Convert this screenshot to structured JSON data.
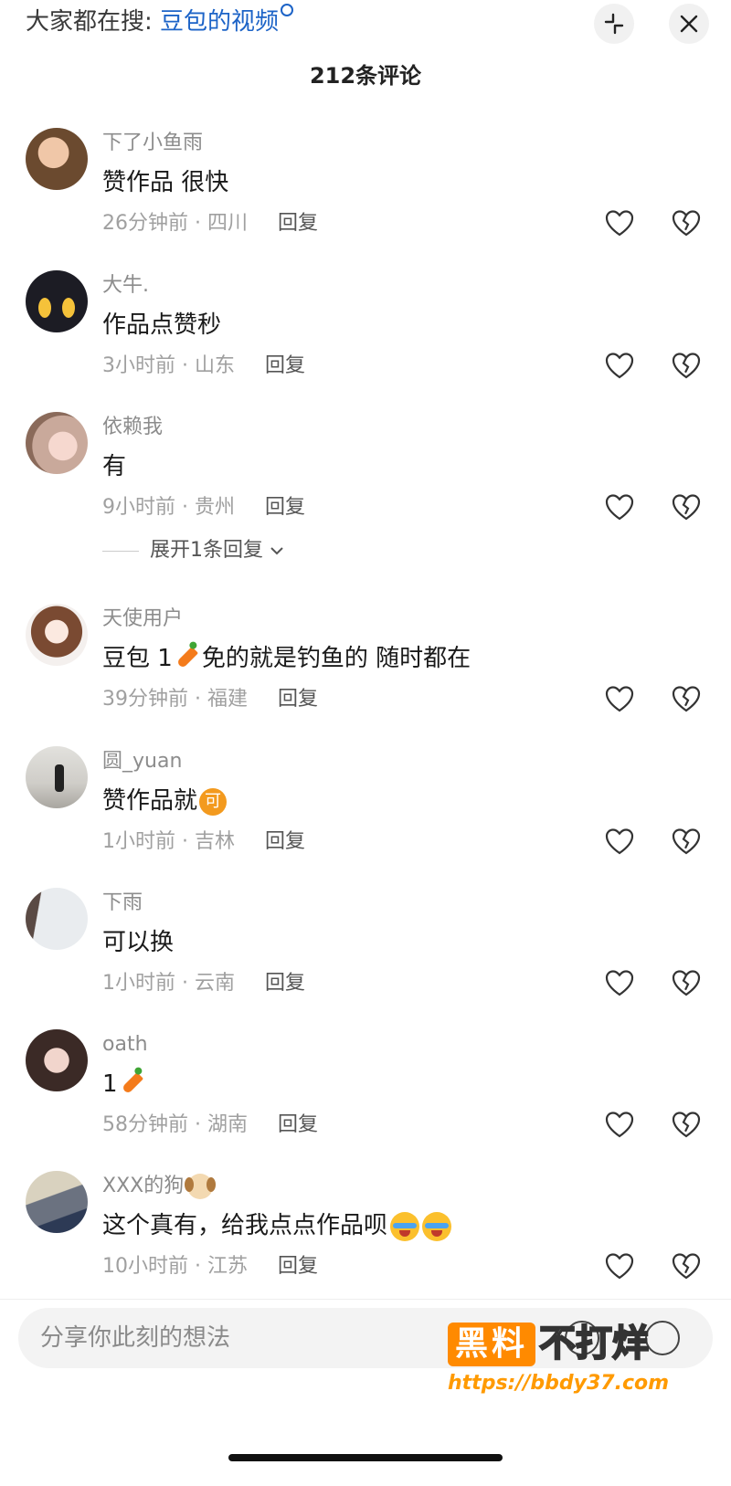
{
  "header": {
    "search_prefix": "大家都在搜:",
    "search_keyword": "豆包的视频",
    "comment_count_title": "212条评论"
  },
  "comments": [
    {
      "username": "下了小鱼雨",
      "text": "赞作品 很快",
      "time": "26分钟前",
      "location": "四川",
      "reply": "回复"
    },
    {
      "username": "大牛.",
      "text": "作品点赞秒",
      "time": "3小时前",
      "location": "山东",
      "reply": "回复"
    },
    {
      "username": "依赖我",
      "text": "有",
      "time": "9小时前",
      "location": "贵州",
      "reply": "回复"
    },
    {
      "username": "天使用户",
      "text_a": "豆包 1",
      "text_b": "免的就是钓鱼的 随时都在",
      "time": "39分钟前",
      "location": "福建",
      "reply": "回复"
    },
    {
      "username": "圆_yuan",
      "text": "赞作品就",
      "emoji_label": "可",
      "time": "1小时前",
      "location": "吉林",
      "reply": "回复"
    },
    {
      "username": "下雨",
      "text": "可以换",
      "time": "1小时前",
      "location": "云南",
      "reply": "回复"
    },
    {
      "username": "oath",
      "text": "1",
      "time": "58分钟前",
      "location": "湖南",
      "reply": "回复"
    },
    {
      "username": "XXX的狗",
      "text": "这个真有，给我点点作品呗",
      "time": "10小时前",
      "location": "江苏",
      "reply": "回复"
    }
  ],
  "expand_replies": "展开1条回复",
  "meta_separator": "·",
  "input": {
    "placeholder": "分享你此刻的想法"
  },
  "watermark": {
    "brand": "黑料",
    "text": "不打烊",
    "url": "https://bbdy37.com"
  },
  "colors": {
    "accent": "#1c63c7",
    "watermark": "#ff8a00"
  }
}
